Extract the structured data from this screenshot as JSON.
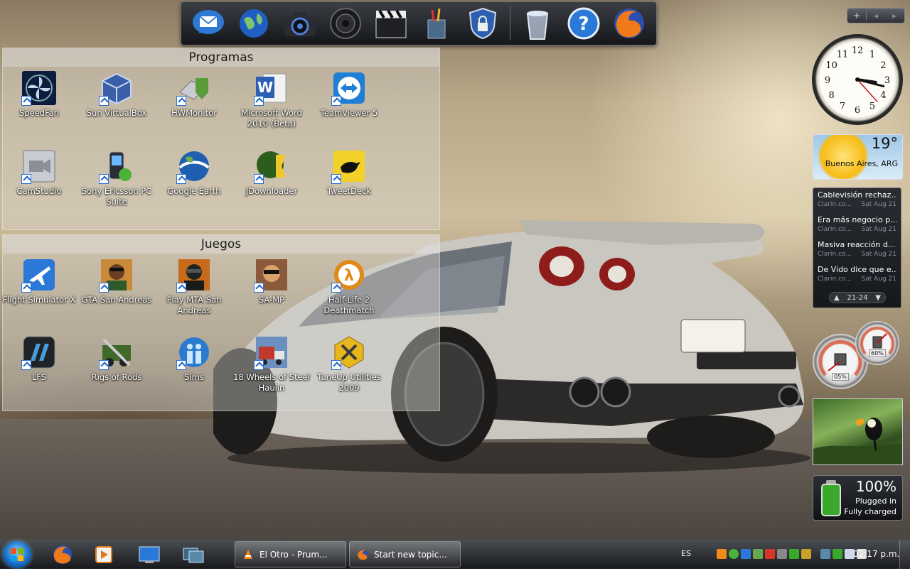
{
  "dock": {
    "items": [
      {
        "name": "mail-icon"
      },
      {
        "name": "globe-icon"
      },
      {
        "name": "camera-icon"
      },
      {
        "name": "speaker-icon"
      },
      {
        "name": "clapperboard-icon"
      },
      {
        "name": "pencil-cup-icon"
      },
      {
        "name": "security-shield-icon"
      },
      {
        "name": "recycle-bin-icon"
      },
      {
        "name": "help-icon"
      },
      {
        "name": "firefox-icon"
      }
    ]
  },
  "fence_programs": {
    "title": "Programas",
    "icons": [
      {
        "label": "SpeedFan",
        "icon": "fan-icon",
        "color": "#0d1b3d"
      },
      {
        "label": "Sun VirtualBox",
        "icon": "virtualbox-icon",
        "color": "#3a5ea8"
      },
      {
        "label": "HWMonitor",
        "icon": "hwmonitor-icon",
        "color": "#5a9b3a"
      },
      {
        "label": "Microsoft Word 2010 (Beta)",
        "icon": "word-icon",
        "color": "#2b5fb4"
      },
      {
        "label": "TeamViewer 5",
        "icon": "teamviewer-icon",
        "color": "#1f7ed6"
      },
      {
        "label": "CamStudio",
        "icon": "camstudio-icon",
        "color": "#c9ccd2"
      },
      {
        "label": "Sony Ericsson PC Suite",
        "icon": "phone-icon",
        "color": "#2a4a2a"
      },
      {
        "label": "Google Earth",
        "icon": "earth-icon",
        "color": "#1f5fb0"
      },
      {
        "label": "JDownloader",
        "icon": "jdownloader-icon",
        "color": "#2c5d1c"
      },
      {
        "label": "TweetDeck",
        "icon": "tweetdeck-icon",
        "color": "#f2d128"
      }
    ]
  },
  "fence_games": {
    "title": "Juegos",
    "icons": [
      {
        "label": "Flight Simulator X",
        "icon": "airplane-icon",
        "color": "#2a78d8"
      },
      {
        "label": "GTA San Andreas",
        "icon": "gta-icon",
        "color": "#c98a3a"
      },
      {
        "label": "Play MTA San Andreas",
        "icon": "mta-icon",
        "color": "#c76a1a"
      },
      {
        "label": "SA-MP",
        "icon": "samp-icon",
        "color": "#8a5a3a"
      },
      {
        "label": "Half-Life 2 Deathmatch",
        "icon": "half-life-icon",
        "color": "#e08a18"
      },
      {
        "label": "LFS",
        "icon": "lfs-icon",
        "color": "#1e2328"
      },
      {
        "label": "Rigs of Rods",
        "icon": "rigs-of-rods-icon",
        "color": "#3f6a2a"
      },
      {
        "label": "Sims",
        "icon": "sims-icon",
        "color": "#2a7ad0"
      },
      {
        "label": "18 Wheels of Steel Haulin",
        "icon": "truck-icon",
        "color": "#6b8fbf"
      },
      {
        "label": "TuneUp Utilities 2009",
        "icon": "tuneup-icon",
        "color": "#e8b71c"
      }
    ]
  },
  "sidebar": {
    "plus_label": "+",
    "clock": {
      "hour": 3,
      "minute": 17,
      "second": 23
    },
    "weather": {
      "temp": "19°",
      "city": "Buenos Aires, ARG"
    },
    "feed": {
      "items": [
        {
          "title": "Cablevisión rechaz...",
          "source": "Clarin.co...",
          "date": "Sat Aug 21"
        },
        {
          "title": "Era más negocio p...",
          "source": "Clarin.co...",
          "date": "Sat Aug 21"
        },
        {
          "title": "Masiva reacción d...",
          "source": "Clarin.co...",
          "date": "Sat Aug 21"
        },
        {
          "title": "De Vido dice que e...",
          "source": "Clarin.co...",
          "date": "Sat Aug 21"
        }
      ],
      "range": "21-24"
    },
    "meters": {
      "cpu": "05%",
      "memory": "60%"
    },
    "battery": {
      "percent": "100%",
      "line1": "Plugged in",
      "line2": "Fully charged"
    }
  },
  "taskbar": {
    "tasks": [
      {
        "label": "El Otro - Prum...",
        "icon": "vlc-icon"
      },
      {
        "label": "Start new topic...",
        "icon": "firefox-icon"
      }
    ],
    "language": "ES",
    "time": "02:17 p.m."
  }
}
